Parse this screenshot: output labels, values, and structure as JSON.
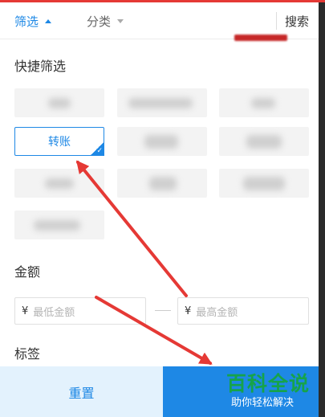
{
  "filter_bar": {
    "tab_filter": "筛选",
    "tab_category": "分类",
    "search": "搜索"
  },
  "quick_filter": {
    "title": "快捷筛选",
    "selected_chip": "转账"
  },
  "amount": {
    "title": "金额",
    "currency_symbol": "¥",
    "min_placeholder": "最低金额",
    "max_placeholder": "最高金额"
  },
  "tags": {
    "title": "标签"
  },
  "footer": {
    "reset": "重置"
  },
  "watermark": {
    "title": "百科全说",
    "subtitle": "助你轻松解决"
  },
  "colors": {
    "accent": "#1e88e5",
    "annotation_arrow": "#e53935",
    "watermark": "#16a34a"
  }
}
